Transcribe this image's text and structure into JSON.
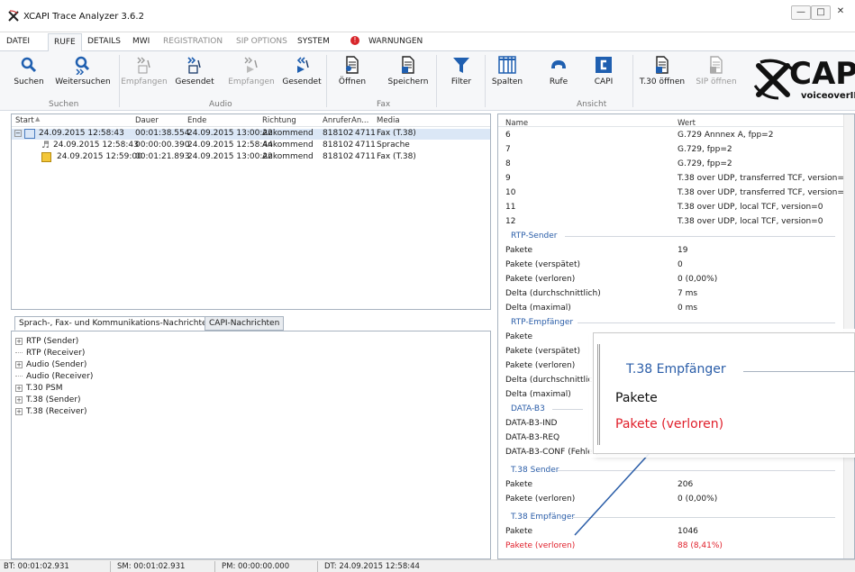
{
  "window": {
    "title": "XCAPI Trace Analyzer 3.6.2"
  },
  "menu": {
    "tabs": [
      "DATEI",
      "RUFE",
      "DETAILS",
      "MWI",
      "REGISTRATION",
      "SIP OPTIONS",
      "SYSTEM",
      "WARNUNGEN"
    ]
  },
  "ribbon": {
    "suchen": {
      "label": "Suchen",
      "buttons": [
        "Suchen",
        "Weitersuchen"
      ]
    },
    "audio": {
      "label": "Audio",
      "buttons": [
        "Empfangen",
        "Gesendet",
        "Empfangen",
        "Gesendet"
      ]
    },
    "fax": {
      "label": "Fax",
      "buttons": [
        "Öffnen",
        "Speichern",
        "Filter"
      ]
    },
    "ansicht": {
      "label": "Ansicht",
      "buttons": [
        "Spalten",
        "Rufe",
        "CAPI",
        "T.30 öffnen",
        "SIP öffnen"
      ]
    },
    "logo_main": "CAPI",
    "logo_sub": "voiceoverIP"
  },
  "calls": {
    "columns": [
      "Start",
      "Dauer",
      "Ende",
      "Richtung",
      "Anrufer",
      "An...",
      "Media"
    ],
    "rows": [
      [
        "24.09.2015 12:58:43",
        "00:01:38.554",
        "24.09.2015 13:00:22",
        "Ankommend",
        "818102",
        "4711",
        "Fax (T.38)"
      ],
      [
        "24.09.2015 12:58:43",
        "00:00:00.390",
        "24.09.2015 12:58:44",
        "Ankommend",
        "818102",
        "4711",
        "Sprache"
      ],
      [
        "24.09.2015 12:59:00",
        "00:01:21.893",
        "24.09.2015 13:00:22",
        "Ankommend",
        "818102",
        "4711",
        "Fax (T.38)"
      ]
    ]
  },
  "messages": {
    "tabs": [
      "Sprach-, Fax- und Kommunikations-Nachrichten",
      "CAPI-Nachrichten"
    ],
    "items": [
      "RTP (Sender)",
      "RTP (Receiver)",
      "Audio (Sender)",
      "Audio (Receiver)",
      "T.30 PSM",
      "T.38 (Sender)",
      "T.38 (Receiver)"
    ]
  },
  "props": {
    "columns": [
      "Name",
      "Wert"
    ],
    "codecs": [
      [
        "6",
        "G.729 Annnex A, fpp=2"
      ],
      [
        "7",
        "G.729, fpp=2"
      ],
      [
        "8",
        "G.729, fpp=2"
      ],
      [
        "9",
        "T.38 over UDP, transferred TCF, version=0"
      ],
      [
        "10",
        "T.38 over UDP, transferred TCF, version=0"
      ],
      [
        "11",
        "T.38 over UDP, local TCF, version=0"
      ],
      [
        "12",
        "T.38 over UDP, local TCF, version=0"
      ]
    ],
    "rtp_sender": {
      "title": "RTP-Sender",
      "rows": [
        [
          "Pakete",
          "19"
        ],
        [
          "Pakete (verspätet)",
          "0"
        ],
        [
          "Pakete (verloren)",
          "0 (0,00%)"
        ],
        [
          "Delta (durchschnittlich)",
          "7 ms"
        ],
        [
          "Delta (maximal)",
          "0 ms"
        ]
      ]
    },
    "rtp_empf": {
      "title": "RTP-Empfänger",
      "rows": [
        [
          "Pakete",
          "0"
        ],
        [
          "Pakete (verspätet)",
          ""
        ],
        [
          "Pakete (verloren)",
          ""
        ],
        [
          "Delta (durchschnittlic",
          ""
        ],
        [
          "Delta (maximal)",
          ""
        ]
      ]
    },
    "data_b3": {
      "title": "DATA-B3",
      "rows": [
        [
          "DATA-B3-IND",
          ""
        ],
        [
          "DATA-B3-REQ",
          ""
        ],
        [
          "DATA-B3-CONF (Fehler)",
          "1"
        ]
      ]
    },
    "t38_sender": {
      "title": "T.38 Sender",
      "rows": [
        [
          "Pakete",
          "206"
        ],
        [
          "Pakete (verloren)",
          "0 (0,00%)"
        ]
      ]
    },
    "t38_empf": {
      "title": "T.38 Empfänger",
      "rows": [
        [
          "Pakete",
          "1046"
        ],
        [
          "Pakete (verloren)",
          "88 (8,41%)"
        ]
      ]
    }
  },
  "callout": {
    "title": "T.38 Empfänger",
    "line1": "Pakete",
    "line2": "Pakete (verloren)"
  },
  "status": {
    "bt": "BT: 00:01:02.931",
    "sm": "SM: 00:01:02.931",
    "pm": "PM: 00:00:00.000",
    "dt": "DT: 24.09.2015 12:58:44"
  },
  "colors": {
    "accent": "#2a5da8",
    "alert": "#e0202b",
    "selected": "#dbe7f6"
  }
}
